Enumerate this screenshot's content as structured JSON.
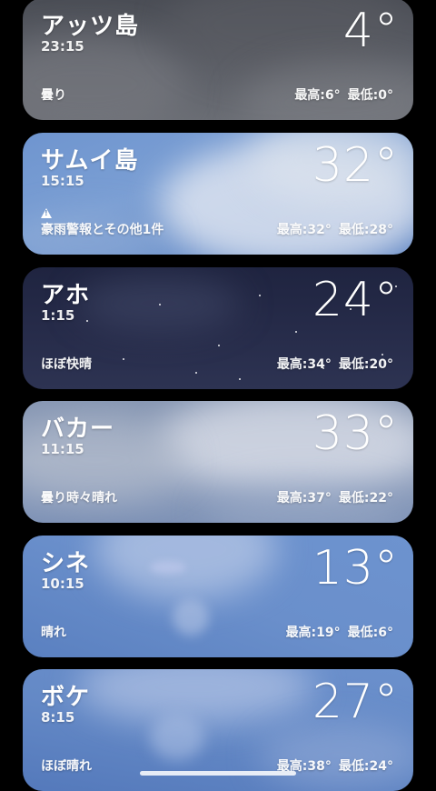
{
  "cities": [
    {
      "name": "アッツ島",
      "time": "23:15",
      "temp": "4°",
      "condition": "曇り",
      "high": "最高:6°",
      "low": "最低:0°",
      "alert": false,
      "theme": "overcast-dark"
    },
    {
      "name": "サムイ島",
      "time": "15:15",
      "temp": "32°",
      "condition": "豪雨警報とその他1件",
      "high": "最高:32°",
      "low": "最低:28°",
      "alert": true,
      "theme": "cloudy-blue"
    },
    {
      "name": "アホ",
      "time": "1:15",
      "temp": "24°",
      "condition": "ほぼ快晴",
      "high": "最高:34°",
      "low": "最低:20°",
      "alert": false,
      "theme": "night-clear"
    },
    {
      "name": "バカー",
      "time": "11:15",
      "temp": "33°",
      "condition": "曇り時々晴れ",
      "high": "最高:37°",
      "low": "最低:22°",
      "alert": false,
      "theme": "partly-cloudy"
    },
    {
      "name": "シネ",
      "time": "10:15",
      "temp": "13°",
      "condition": "晴れ",
      "high": "最高:19°",
      "low": "最低:6°",
      "alert": false,
      "theme": "sunny"
    },
    {
      "name": "ボケ",
      "time": "8:15",
      "temp": "27°",
      "condition": "ほぼ晴れ",
      "high": "最高:38°",
      "low": "最低:24°",
      "alert": false,
      "theme": "mostly-sunny"
    }
  ],
  "colors": {
    "overcast-dark": "#5b5e66",
    "cloudy-blue": "#5f86c4",
    "night-clear": "#252a45",
    "partly-cloudy": "#8ea0bd",
    "sunny": "#5f86c6",
    "mostly-sunny": "#5a7fbd"
  },
  "icons": {
    "alert": "warning-triangle-icon"
  }
}
